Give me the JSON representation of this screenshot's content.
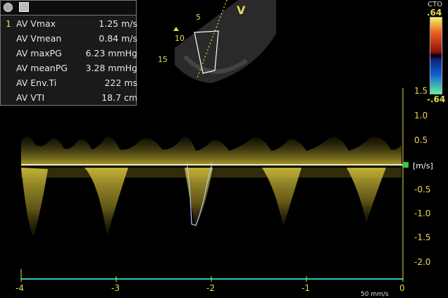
{
  "measurements": {
    "rows": [
      {
        "index": "1",
        "label": "AV Vmax",
        "value": "1.25 m/s"
      },
      {
        "index": "",
        "label": "AV Vmean",
        "value": "0.84 m/s"
      },
      {
        "index": "",
        "label": "AV maxPG",
        "value": "6.23 mmHg"
      },
      {
        "index": "",
        "label": "AV meanPG",
        "value": "3.28 mmHg"
      },
      {
        "index": "",
        "label": "AV Env.Ti",
        "value": "222 ms"
      },
      {
        "index": "",
        "label": "AV VTI",
        "value": "18.7 cm"
      }
    ]
  },
  "image": {
    "probe_letter": "V",
    "cto_label": "CTO",
    "scale_top": ".64",
    "scale_bottom": "-.64",
    "depth_marks": [
      "5",
      "10",
      "15"
    ]
  },
  "velocity_axis": {
    "ticks": [
      "1.5",
      "1.0",
      "0.5",
      "-0.5",
      "-1.0",
      "-1.5",
      "-2.0"
    ],
    "unit": "[m/s]"
  },
  "time_axis": {
    "ticks": [
      "-4",
      "-3",
      "-2",
      "-1",
      "0"
    ],
    "sweep": "50 mm/s"
  },
  "colors": {
    "accent_yellow": "#e8d850",
    "baseline": "#28d040",
    "axis_line": "#2ec8b0"
  }
}
